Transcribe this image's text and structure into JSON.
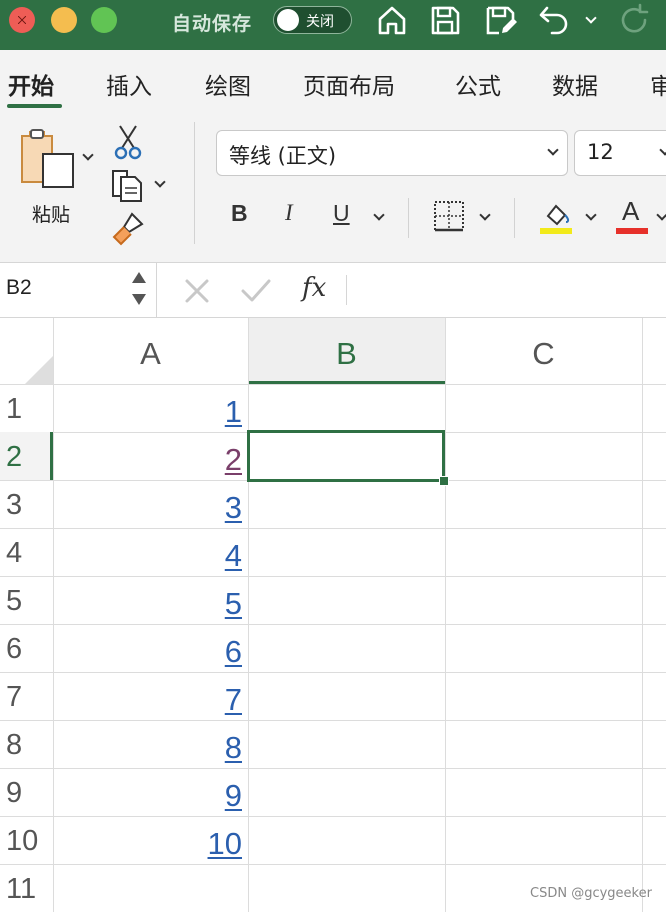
{
  "window": {
    "autosave_label": "自动保存",
    "autosave_state": "关闭",
    "titlebar_color": "#2f7044"
  },
  "toolbar_icons": [
    "home-icon",
    "save-icon",
    "save-as-icon",
    "undo-icon",
    "undo-dropdown-icon",
    "redo-icon"
  ],
  "ribbon": {
    "tabs": [
      {
        "label": "开始",
        "active": true
      },
      {
        "label": "插入",
        "active": false
      },
      {
        "label": "绘图",
        "active": false
      },
      {
        "label": "页面布局",
        "active": false
      },
      {
        "label": "公式",
        "active": false
      },
      {
        "label": "数据",
        "active": false
      },
      {
        "label": "审",
        "active": false
      }
    ],
    "paste_label": "粘贴",
    "font_name": "等线 (正文)",
    "font_size": "12",
    "bold_label": "B",
    "italic_label": "I",
    "underline_label": "U",
    "font_color_label": "A",
    "highlight_color": "#f2ea1a",
    "font_color": "#e6302a"
  },
  "formula_bar": {
    "name_box": "B2",
    "fx_label": "fx",
    "formula": ""
  },
  "sheet": {
    "columns": [
      "A",
      "B",
      "C"
    ],
    "selected_column": "B",
    "rows": [
      "1",
      "2",
      "3",
      "4",
      "5",
      "6",
      "7",
      "8",
      "9",
      "10",
      "11"
    ],
    "selected_row": "2",
    "active_cell": "B2",
    "column_a_values": [
      "1",
      "2",
      "3",
      "4",
      "5",
      "6",
      "7",
      "8",
      "9",
      "10",
      ""
    ],
    "visited_link_row": "2",
    "link_color": "#2b5fae",
    "visited_link_color": "#7a3f6a"
  },
  "watermark": "CSDN @gcygeeker"
}
